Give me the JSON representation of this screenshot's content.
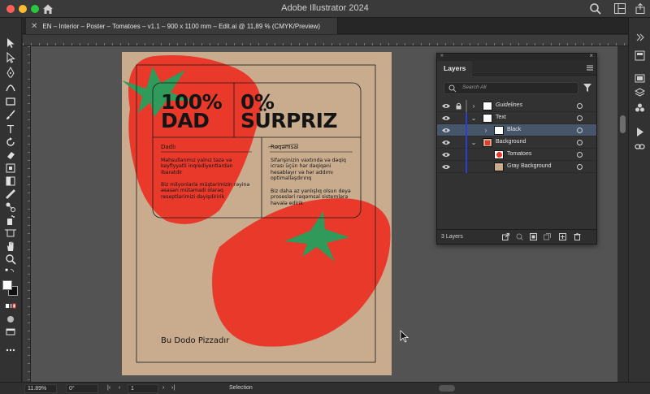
{
  "app": {
    "title": "Adobe Illustrator 2024"
  },
  "document": {
    "tab_label": "EN – Interior – Poster – Tomatoes – v1.1 – 900 x 1100 mm – Edit.ai @ 11,89 % (CMYK/Preview)"
  },
  "poster": {
    "headline_left": [
      "100%",
      "DAD"
    ],
    "headline_right": [
      "0%",
      "SÜRPRIZ"
    ],
    "col_left": {
      "heading": "Dadlı",
      "para1": "Məhsullarımız yalnız təzə və keyfiyyətli inqrediyentlərdən ibarətdir",
      "para2": "Biz milyonlarla müştərimizin rəyinə əsasən mütəmadi olaraq reseptlərimizi dəyişdiririk"
    },
    "col_right": {
      "heading": "Rəqəmsal",
      "para1": "Sifarişinizin vaxtında və dəqiq icrası üçün hər dəqiqəni hesablayır və hər addımı optimallaşdırırıq",
      "para2": "Biz daha az yanlışlıq olsun deyə prosesləri rəqəmsal sistemlərə həvalə edirik"
    },
    "footer": "Bu Dodo Pizzadır",
    "colors": {
      "tomato": "#e8392b",
      "leaf": "#2f9a5a",
      "paper": "#c9ab8e"
    }
  },
  "layers_panel": {
    "tab": "Layers",
    "search_placeholder": "Search All",
    "rows": [
      {
        "name": "Guidelines",
        "italic": true
      },
      {
        "name": "Text"
      },
      {
        "name": "Black",
        "selected": true
      },
      {
        "name": "Background"
      },
      {
        "name": "Tomatoes"
      },
      {
        "name": "Gray Background"
      }
    ],
    "count": "3 Layers"
  },
  "status": {
    "zoom": "11.89%",
    "rotation": "0°",
    "artboard": "1",
    "tool": "Selection"
  }
}
